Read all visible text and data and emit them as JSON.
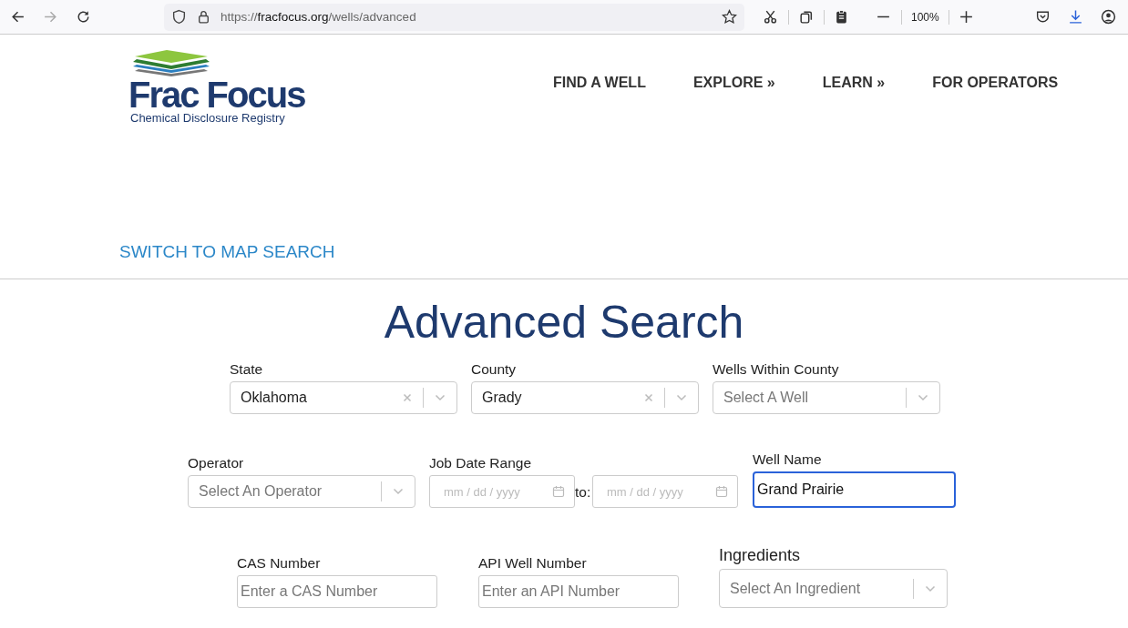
{
  "browser": {
    "url_scheme": "https://",
    "url_host": "fracfocus.org",
    "url_path": "/wells/advanced",
    "forward_disabled": true,
    "zoom": "100%"
  },
  "logo": {
    "name": "Frac Focus",
    "tagline": "Chemical Disclosure Registry"
  },
  "nav": [
    "FIND A WELL",
    "EXPLORE »",
    "LEARN »",
    "FOR OPERATORS"
  ],
  "switch_link": "SWITCH TO MAP SEARCH",
  "title": "Advanced Search",
  "rows": [
    [
      {
        "kind": "select",
        "label": "State",
        "value": "Oklahoma"
      },
      {
        "kind": "select",
        "label": "County",
        "value": "Grady"
      },
      {
        "kind": "select",
        "label": "Wells Within County",
        "placeholder": "Select A Well"
      }
    ],
    [
      {
        "kind": "select",
        "label": "Operator",
        "placeholder": "Select An Operator"
      },
      {
        "kind": "date_range",
        "label": "Job Date Range",
        "from_placeholder": "mm / dd / yyyy",
        "separator": "to:",
        "to_placeholder": "mm / dd / yyyy"
      },
      {
        "kind": "text",
        "label": "Well Name",
        "value": "Grand Prairie",
        "focused": true
      }
    ],
    [
      {
        "kind": "text",
        "label": "CAS Number",
        "placeholder": "Enter a CAS Number",
        "focused": false
      },
      {
        "kind": "text",
        "label": "API Well Number",
        "placeholder": "Enter an API Number",
        "focused": false
      },
      {
        "kind": "select",
        "label": "Ingredients",
        "placeholder": "Select An Ingredient"
      }
    ]
  ]
}
